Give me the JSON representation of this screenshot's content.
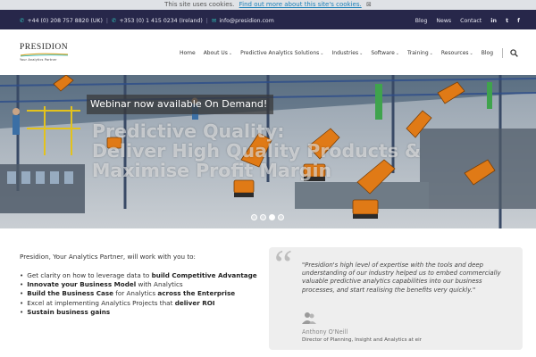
{
  "cookie": {
    "text": "This site uses cookies.",
    "link": "Find out more about this site's cookies.",
    "close_glyph": "⊠"
  },
  "topbar": {
    "phone_uk": "+44 (0) 208 757 8820 (UK)",
    "phone_ie": "+353 (0) 1 415 0234 (Ireland)",
    "email": "info@presidion.com",
    "links": [
      "Blog",
      "News",
      "Contact"
    ],
    "social": [
      "in",
      "t",
      "f"
    ]
  },
  "logo": {
    "brand": "PRESIDION",
    "tagline": "Your Analytics Partner"
  },
  "nav": {
    "items": [
      {
        "label": "Home",
        "has_menu": false
      },
      {
        "label": "About Us",
        "has_menu": true
      },
      {
        "label": "Predictive Analytics Solutions",
        "has_menu": true
      },
      {
        "label": "Industries",
        "has_menu": true
      },
      {
        "label": "Software",
        "has_menu": true
      },
      {
        "label": "Training",
        "has_menu": true
      },
      {
        "label": "Resources",
        "has_menu": true
      },
      {
        "label": "Blog",
        "has_menu": false
      }
    ],
    "search_icon": "search-icon"
  },
  "hero": {
    "banner": "Webinar now available On Demand!",
    "headline_lines": [
      "Predictive Quality:",
      "Deliver High Quality Products &",
      "Maximise Profit Margin"
    ],
    "slides": 4,
    "active_slide": 2
  },
  "content": {
    "intro": "Presidion, Your Analytics Partner, will work with you to:",
    "bullets": [
      {
        "parts": [
          {
            "t": "Get clarity on how to leverage data to ",
            "b": false
          },
          {
            "t": "build Competitive Advantage",
            "b": true
          }
        ]
      },
      {
        "parts": [
          {
            "t": "Innovate your Business Model",
            "b": true
          },
          {
            "t": " with Analytics",
            "b": false
          }
        ]
      },
      {
        "parts": [
          {
            "t": "Build the Business Case",
            "b": true
          },
          {
            "t": " for Analytics ",
            "b": false
          },
          {
            "t": "across the Enterprise",
            "b": true
          }
        ]
      },
      {
        "parts": [
          {
            "t": "Excel at implementing Analytics Projects that ",
            "b": false
          },
          {
            "t": "deliver ROI",
            "b": true
          }
        ]
      },
      {
        "parts": [
          {
            "t": "Sustain business gains",
            "b": true
          }
        ]
      }
    ]
  },
  "testimonial": {
    "quote": "\"Presidion's high level of expertise with the tools and deep understanding of our industry helped us to embed commercially valuable predictive analytics capabilities into our business processes, and start realising the benefits very quickly.\"",
    "name": "Anthony O'Neill",
    "role": "Director of Planning, Insight and Analytics at eir"
  },
  "colors": {
    "topbar_bg": "#27274a",
    "accent": "#2fb6b0",
    "link": "#1a7fb8"
  }
}
